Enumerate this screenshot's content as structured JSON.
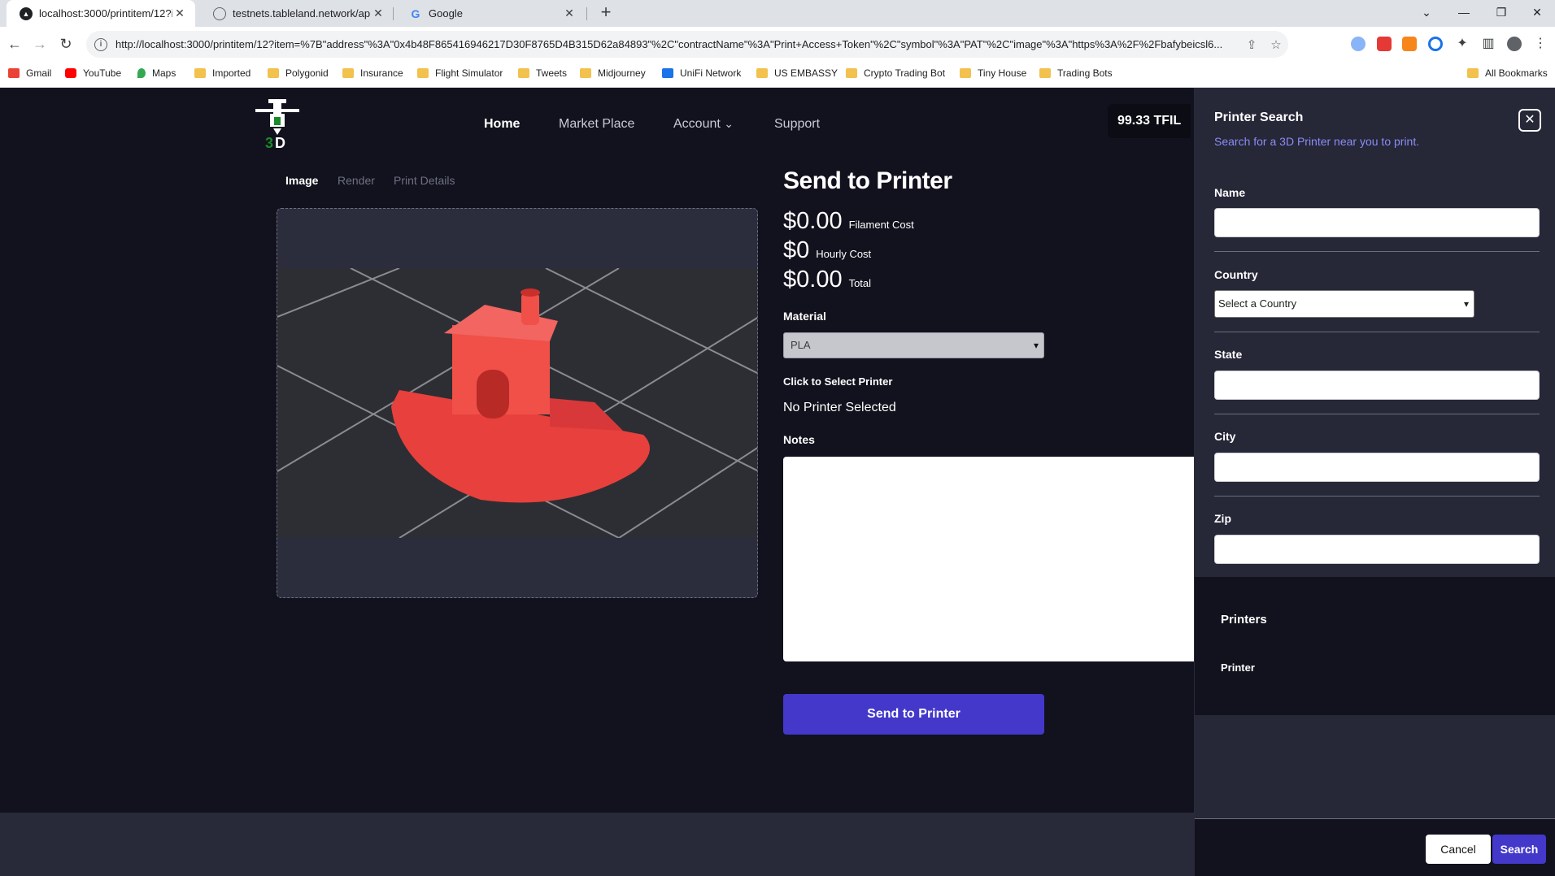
{
  "browser": {
    "tabs": [
      {
        "title": "localhost:3000/printitem/12?item",
        "close": "✕"
      },
      {
        "title": "testnets.tableland.network/api/v",
        "close": "✕"
      },
      {
        "title": "Google",
        "close": "✕"
      }
    ],
    "new_tab": "+",
    "url": "http://localhost:3000/printitem/12?item=%7B\"address\"%3A\"0x4b48F865416946217D30F8765D4B315D62a84893\"%2C\"contractName\"%3A\"Print+Access+Token\"%2C\"symbol\"%3A\"PAT\"%2C\"image\"%3A\"https%3A%2F%2Fbafybeicsl6...",
    "bookmarks": [
      "Gmail",
      "YouTube",
      "Maps",
      "Imported",
      "Polygonid",
      "Insurance",
      "Flight Simulator",
      "Tweets",
      "Midjourney",
      "UniFi Network",
      "US EMBASSY",
      "Crypto Trading Bot",
      "Tiny House",
      "Trading Bots"
    ],
    "all_bookmarks": "All Bookmarks"
  },
  "header": {
    "nav": [
      "Home",
      "Market Place",
      "Account",
      "Support"
    ],
    "account_chevron": "⌄",
    "balance": "99.33 TFIL"
  },
  "subtabs": [
    "Image",
    "Render",
    "Print Details"
  ],
  "send": {
    "title": "Send to Printer",
    "costs": [
      {
        "amount": "$0.00",
        "label": "Filament Cost"
      },
      {
        "amount": "$0",
        "label": "Hourly Cost"
      },
      {
        "amount": "$0.00",
        "label": "Total"
      }
    ],
    "material_label": "Material",
    "material_value": "PLA",
    "select_printer_label": "Click to Select Printer",
    "no_printer": "No Printer Selected",
    "notes_label": "Notes",
    "send_button": "Send to Printer"
  },
  "panel": {
    "title": "Printer Search",
    "subtitle": "Search for a 3D Printer near you to print.",
    "close": "✕",
    "name_label": "Name",
    "country_label": "Country",
    "country_placeholder": "Select a Country",
    "state_label": "State",
    "city_label": "City",
    "zip_label": "Zip",
    "printers_title": "Printers",
    "printer_column": "Printer",
    "cancel": "Cancel",
    "search": "Search"
  },
  "colors": {
    "accent": "#4338ca",
    "app_bg": "#11121d",
    "panel_bg": "#262737",
    "link": "#8b8cf6"
  }
}
